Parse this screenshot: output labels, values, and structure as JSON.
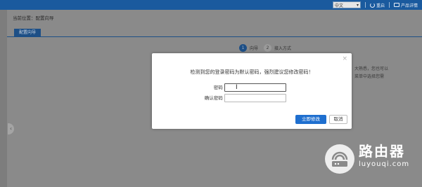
{
  "topbar": {
    "language": "中文",
    "reboot_label": "重启",
    "product_label": "产品详情"
  },
  "page": {
    "breadcrumb": "当前位置：配置向导",
    "active_tab": "配置向导",
    "steps": [
      {
        "number": "1",
        "label": "向导"
      },
      {
        "number": "2",
        "label": "接入方式"
      }
    ],
    "behind_text": [
      "大熟悉，您也可以",
      "菜单中选择您需"
    ]
  },
  "modal": {
    "close_glyph": "×",
    "message": "检测到您的登录密码为默认密码，强烈建议您修改密码！",
    "password_label": "密码",
    "confirm_label": "确认密码",
    "required_mark": "*",
    "password_value": "",
    "confirm_value": "",
    "submit_label": "立即修改",
    "cancel_label": "取消"
  },
  "watermark": {
    "title": "路由器",
    "subtitle": "luyouqi.com"
  },
  "colors": {
    "topbar": "#1a5a9e",
    "primary_button": "#1f6fcf",
    "required": "#d9251c",
    "overlay": "#8a8a8a"
  },
  "icons": [
    "chevron-down-icon",
    "reboot-icon",
    "product-icon",
    "close-icon",
    "collapse-arrow-icon",
    "text-cursor-icon",
    "router-logo-icon"
  ]
}
